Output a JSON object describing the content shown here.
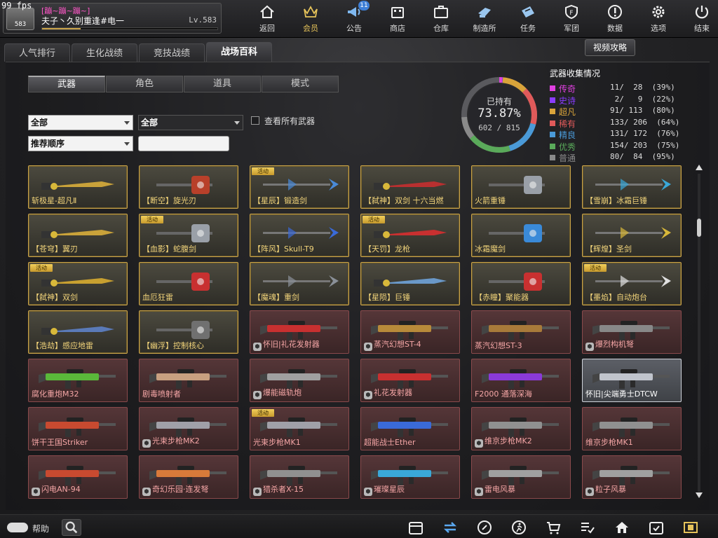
{
  "fps": "99 fps",
  "player": {
    "avatar_label": "583",
    "clan": "[蹦~蹦~蹦~]",
    "name": "夫子丶久别重逢#电一",
    "level": "Lv.583"
  },
  "nav": [
    {
      "label": "返回",
      "icon": "home-icon"
    },
    {
      "label": "会员",
      "icon": "crown-icon"
    },
    {
      "label": "公告",
      "icon": "megaphone-icon",
      "badge": "11"
    },
    {
      "label": "商店",
      "icon": "shop-icon"
    },
    {
      "label": "仓库",
      "icon": "briefcase-icon"
    },
    {
      "label": "制造所",
      "icon": "forge-icon"
    },
    {
      "label": "任务",
      "icon": "ticket-icon"
    },
    {
      "label": "军团",
      "icon": "shield-icon"
    },
    {
      "label": "数据",
      "icon": "info-icon"
    },
    {
      "label": "选项",
      "icon": "gear-icon"
    },
    {
      "label": "结束",
      "icon": "power-icon"
    }
  ],
  "main_tabs": [
    "人气排行",
    "生化战绩",
    "竞技战绩",
    "战场百科"
  ],
  "video_button": "视频攻略",
  "sub_tabs": [
    "武器",
    "角色",
    "道具",
    "模式"
  ],
  "filters": {
    "filter1": "全部",
    "filter2": "全部",
    "sort": "推荐顺序",
    "search_value": "",
    "show_all_label": "查看所有武器"
  },
  "collection": {
    "owned_label": "已持有",
    "percent": "73.87%",
    "count": "602 / 815",
    "title": "武器收集情况",
    "owned_fraction": 0.7387,
    "rows": [
      {
        "name": "传奇",
        "count": "11/  28  (39%)",
        "color": "#e040e0"
      },
      {
        "name": "史诗",
        "count": " 2/   9  (22%)",
        "color": "#8a3cff"
      },
      {
        "name": "超凡",
        "count": "91/ 113  (80%)",
        "color": "#d9a43a"
      },
      {
        "name": "稀有",
        "count": "133/ 206  (64%)",
        "color": "#e05a5a"
      },
      {
        "name": "精良",
        "count": "131/ 172  (76%)",
        "color": "#4a9ad8"
      },
      {
        "name": "优秀",
        "count": "154/ 203  (75%)",
        "color": "#5aaa5a"
      },
      {
        "name": "普通",
        "count": "80/  84  (95%)",
        "color": "#8a8a8a"
      }
    ]
  },
  "event_tag": "活动",
  "weapons": [
    {
      "name": "斩极星-超凡Ⅱ",
      "style": "gold",
      "event": false,
      "icon": false,
      "color": "#c9a23a"
    },
    {
      "name": "【断空】旋光刃",
      "style": "gold",
      "event": false,
      "icon": false,
      "color": "#b8402a"
    },
    {
      "name": "【星辰】锻造剑",
      "style": "gold",
      "event": true,
      "icon": false,
      "color": "#4a8ad8"
    },
    {
      "name": "【弑神】双剑 十六当燃",
      "style": "gold",
      "event": false,
      "icon": false,
      "color": "#b83030"
    },
    {
      "name": "火箭重锤",
      "style": "gold",
      "event": false,
      "icon": false,
      "color": "#9aa0a8"
    },
    {
      "name": "【雪崩】冰霜巨锤",
      "style": "gold",
      "event": false,
      "icon": false,
      "color": "#3aa8d8"
    },
    {
      "name": "【苍穹】翼刃",
      "style": "gold",
      "event": false,
      "icon": false,
      "color": "#c9a23a"
    },
    {
      "name": "【血影】蛇腹剑",
      "style": "gold",
      "event": true,
      "icon": false,
      "color": "#9aa0a8"
    },
    {
      "name": "【阵风】Skull-T9",
      "style": "gold",
      "event": false,
      "icon": false,
      "color": "#3a6ad8"
    },
    {
      "name": "【天罚】龙枪",
      "style": "gold",
      "event": true,
      "icon": false,
      "color": "#c83030"
    },
    {
      "name": "冰霜魔剑",
      "style": "gold",
      "event": false,
      "icon": false,
      "color": "#3a8ad8"
    },
    {
      "name": "【辉煌】圣剑",
      "style": "gold",
      "event": false,
      "icon": false,
      "color": "#d8b83a"
    },
    {
      "name": "【弑神】双剑",
      "style": "gold",
      "event": true,
      "icon": false,
      "color": "#c8a030"
    },
    {
      "name": "血厄狂雷",
      "style": "gold",
      "event": false,
      "icon": false,
      "color": "#c83030"
    },
    {
      "name": "【魔魂】重剑",
      "style": "gold",
      "event": false,
      "icon": false,
      "color": "#8a9098"
    },
    {
      "name": "【星陨】巨锤",
      "style": "gold",
      "event": false,
      "icon": false,
      "color": "#6a98c8"
    },
    {
      "name": "【赤瞳】聚能器",
      "style": "gold",
      "event": false,
      "icon": false,
      "color": "#c83030"
    },
    {
      "name": "【墨焰】自动炮台",
      "style": "gold",
      "event": true,
      "icon": false,
      "color": "#e0e0e0"
    },
    {
      "name": "【浩劫】感应地雷",
      "style": "gold",
      "event": false,
      "icon": false,
      "color": "#5a7ab8"
    },
    {
      "name": "【幽浮】控制核心",
      "style": "gold",
      "event": false,
      "icon": false,
      "color": "#707070"
    },
    {
      "name": "怀旧|礼花发射器",
      "style": "red",
      "event": false,
      "icon": true,
      "color": "#c83030"
    },
    {
      "name": "蒸汽幻想ST-4",
      "style": "red",
      "event": false,
      "icon": true,
      "color": "#b88a3a"
    },
    {
      "name": "蒸汽幻想ST-3",
      "style": "red",
      "event": false,
      "icon": false,
      "color": "#a87a3a"
    },
    {
      "name": "爆烈构机弩",
      "style": "red",
      "event": false,
      "icon": true,
      "color": "#888888"
    },
    {
      "name": "腐化重炮M32",
      "style": "red",
      "event": false,
      "icon": false,
      "color": "#5ab83a"
    },
    {
      "name": "剧毒喷射者",
      "style": "red",
      "event": false,
      "icon": false,
      "color": "#c8a080"
    },
    {
      "name": "爆能磁轨炮",
      "style": "red",
      "event": false,
      "icon": true,
      "color": "#a0a0a0"
    },
    {
      "name": "礼花发射器",
      "style": "red",
      "event": false,
      "icon": true,
      "color": "#c83030"
    },
    {
      "name": "F2000 通落深海",
      "style": "red",
      "event": false,
      "icon": false,
      "color": "#8a3ad8"
    },
    {
      "name": "怀旧|尖端勇士DTCW",
      "style": "selected",
      "event": false,
      "icon": false,
      "color": "#c0c4cc"
    },
    {
      "name": "饼干王国Striker",
      "style": "red",
      "event": false,
      "icon": false,
      "color": "#c84a30"
    },
    {
      "name": "光束步枪MK2",
      "style": "red",
      "event": false,
      "icon": true,
      "color": "#a0a0a8"
    },
    {
      "name": "光束步枪MK1",
      "style": "red",
      "event": true,
      "icon": false,
      "color": "#a0a0a8"
    },
    {
      "name": "超能战士Ether",
      "style": "red",
      "event": false,
      "icon": false,
      "color": "#3a6ad8"
    },
    {
      "name": "维京步枪MK2",
      "style": "red",
      "event": false,
      "icon": true,
      "color": "#909090"
    },
    {
      "name": "维京步枪MK1",
      "style": "red",
      "event": false,
      "icon": false,
      "color": "#909090"
    },
    {
      "name": "闪电AN-94",
      "style": "red",
      "event": false,
      "icon": true,
      "color": "#c84a30"
    },
    {
      "name": "奇幻乐园·连发弩",
      "style": "red",
      "event": false,
      "icon": true,
      "color": "#d87a3a"
    },
    {
      "name": "猎杀者X-15",
      "style": "red",
      "event": false,
      "icon": true,
      "color": "#909090"
    },
    {
      "name": "璀璨星辰",
      "style": "red",
      "event": false,
      "icon": true,
      "color": "#3aa8d8"
    },
    {
      "name": "雷电风暴",
      "style": "red",
      "event": false,
      "icon": true,
      "color": "#a0a0a0"
    },
    {
      "name": "粒子风暴",
      "style": "red",
      "event": false,
      "icon": true,
      "color": "#a0a0a0"
    }
  ],
  "bottom": {
    "help_label": "帮助",
    "tools": [
      "calendar-icon",
      "refresh-icon",
      "compass-icon",
      "runner-icon",
      "cart-icon",
      "checklist-icon",
      "house-icon",
      "check-calendar-icon",
      "film-icon"
    ]
  }
}
